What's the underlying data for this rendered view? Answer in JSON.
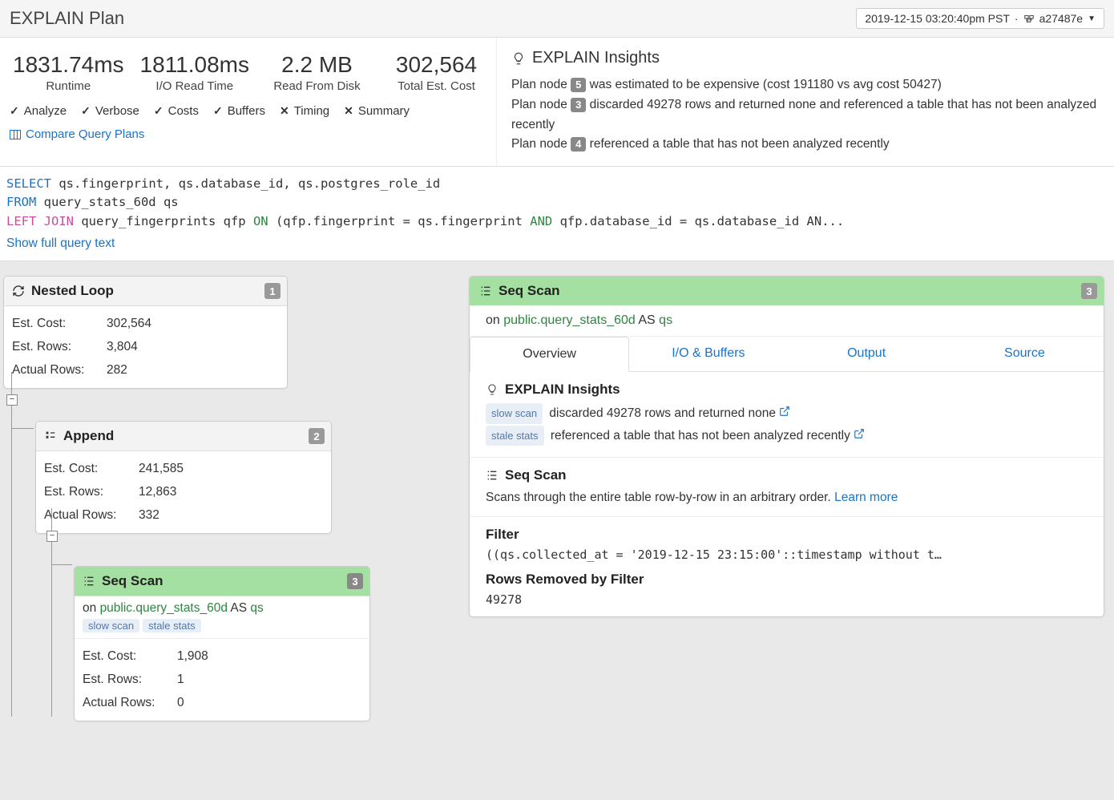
{
  "header": {
    "title": "EXPLAIN Plan",
    "timestamp": "2019-12-15 03:20:40pm PST",
    "commit": "a27487e"
  },
  "metrics": {
    "runtime": {
      "value": "1831.74ms",
      "label": "Runtime"
    },
    "io": {
      "value": "1811.08ms",
      "label": "I/O Read Time"
    },
    "disk": {
      "value": "2.2 MB",
      "label": "Read From Disk"
    },
    "cost": {
      "value": "302,564",
      "label": "Total Est. Cost"
    }
  },
  "flags": {
    "analyze": "Analyze",
    "verbose": "Verbose",
    "costs": "Costs",
    "buffers": "Buffers",
    "timing": "Timing",
    "summary": "Summary"
  },
  "compare_label": "Compare Query Plans",
  "insights": {
    "title": "EXPLAIN Insights",
    "n5": "5",
    "l5a": "Plan node ",
    "l5b": " was estimated to be expensive (cost 191180 vs avg cost 50427)",
    "n3": "3",
    "l3a": "Plan node ",
    "l3b": " discarded 49278 rows and returned none and referenced a table that has not been analyzed recently",
    "n4": "4",
    "l4a": "Plan node ",
    "l4b": " referenced a table that has not been analyzed recently"
  },
  "sql": {
    "select": "SELECT",
    "cols": " qs.fingerprint, qs.database_id, qs.postgres_role_id",
    "from": "FROM",
    "table": " query_stats_60d qs",
    "left": "LEFT",
    "join": "JOIN",
    "jtable": " query_fingerprints qfp ",
    "on": "ON",
    "cond1": " (qfp.fingerprint = qs.fingerprint ",
    "and": "AND",
    "cond2": " qfp.database_id = qs.database_id AN...",
    "show_full": "Show full query text"
  },
  "tree": {
    "n1": {
      "title": "Nested Loop",
      "num": "1",
      "est_cost_l": "Est. Cost:",
      "est_cost": "302,564",
      "est_rows_l": "Est. Rows:",
      "est_rows": "3,804",
      "act_rows_l": "Actual Rows:",
      "act_rows": "282"
    },
    "n2": {
      "title": "Append",
      "num": "2",
      "est_cost_l": "Est. Cost:",
      "est_cost": "241,585",
      "est_rows_l": "Est. Rows:",
      "est_rows": "12,863",
      "act_rows_l": "Actual Rows:",
      "act_rows": "332"
    },
    "n3": {
      "title": "Seq Scan",
      "num": "3",
      "on": "on ",
      "table": "public.query_stats_60d",
      "as": " AS ",
      "alias": "qs",
      "tag1": "slow scan",
      "tag2": "stale stats",
      "est_cost_l": "Est. Cost:",
      "est_cost": "1,908",
      "est_rows_l": "Est. Rows:",
      "est_rows": "1",
      "act_rows_l": "Actual Rows:",
      "act_rows": "0"
    }
  },
  "detail": {
    "title": "Seq Scan",
    "num": "3",
    "on": "on ",
    "table": "public.query_stats_60d",
    "as": " AS ",
    "alias": "qs",
    "tabs": {
      "overview": "Overview",
      "io": "I/O & Buffers",
      "output": "Output",
      "source": "Source"
    },
    "insights_title": "EXPLAIN Insights",
    "in1_tag": "slow scan",
    "in1_text": " discarded 49278 rows and returned none ",
    "in2_tag": "stale stats",
    "in2_text": " referenced a table that has not been analyzed recently ",
    "scan_title": "Seq Scan",
    "scan_desc": "Scans through the entire table row-by-row in an arbitrary order. ",
    "learn_more": "Learn more",
    "filter_title": "Filter",
    "filter_code": "((qs.collected_at = '2019-12-15 23:15:00'::timestamp without t…",
    "removed_title": "Rows Removed by Filter",
    "removed_count": "49278"
  }
}
